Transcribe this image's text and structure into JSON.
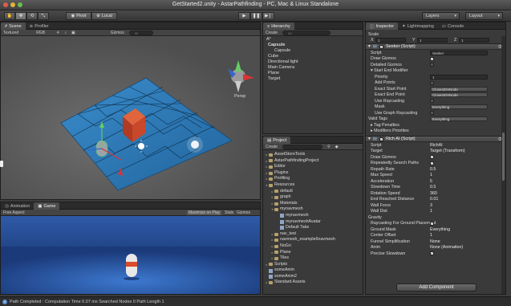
{
  "window": {
    "title": "GetStarted2.unity - AstarPathfinding - PC, Mac & Linux Standalone"
  },
  "toolbar": {
    "pivot_label": "Pivot",
    "local_label": "Local",
    "layers_label": "Layers",
    "layout_label": "Layout"
  },
  "scene_panel": {
    "tabs": [
      "Scene",
      "Profiler"
    ],
    "shading_mode": "Textured",
    "render_mode": "RGB",
    "gizmos_label": "Gizmos",
    "search_placeholder": "All",
    "persp_label": "Persp"
  },
  "game_panel": {
    "tabs": [
      "Animation",
      "Game"
    ],
    "aspect": "Free Aspect",
    "maximize_label": "Maximize on Play",
    "stats_label": "Stats",
    "gizmos_label": "Gizmos"
  },
  "hierarchy": {
    "tab": "Hierarchy",
    "create_label": "Create",
    "search_placeholder": "All",
    "rows": [
      {
        "label": "Capsule",
        "bold": true
      },
      {
        "label": "Capsule",
        "child": true
      },
      {
        "label": "Cube"
      },
      {
        "label": "Directional light"
      },
      {
        "label": "Main Camera"
      },
      {
        "label": "Plane"
      },
      {
        "label": "Target"
      }
    ]
  },
  "project": {
    "tab": "Project",
    "create_label": "Create",
    "rows": [
      {
        "label": "AssetStoreTools",
        "depth": 0,
        "type": "folder"
      },
      {
        "label": "AstarPathfindingProject",
        "depth": 0,
        "type": "folder"
      },
      {
        "label": "Editor",
        "depth": 0,
        "type": "folder"
      },
      {
        "label": "Plugins",
        "depth": 0,
        "type": "folder"
      },
      {
        "label": "Profiling",
        "depth": 0,
        "type": "folder"
      },
      {
        "label": "Resources",
        "depth": 0,
        "type": "folder",
        "open": true
      },
      {
        "label": "default",
        "depth": 1,
        "type": "folder"
      },
      {
        "label": "graph",
        "depth": 1,
        "type": "folder"
      },
      {
        "label": "Materials",
        "depth": 1,
        "type": "folder"
      },
      {
        "label": "mynavmesh",
        "depth": 1,
        "type": "folder",
        "open": true
      },
      {
        "label": "mynavmesh",
        "depth": 2,
        "type": "asset"
      },
      {
        "label": "mynavmeshAvatar",
        "depth": 2,
        "type": "asset"
      },
      {
        "label": "Default Take",
        "depth": 2,
        "type": "asset"
      },
      {
        "label": "nav_test",
        "depth": 1,
        "type": "folder"
      },
      {
        "label": "navmesh_example6navmesh",
        "depth": 1,
        "type": "folder"
      },
      {
        "label": "NoGri",
        "depth": 1,
        "type": "folder"
      },
      {
        "label": "Plane",
        "depth": 1,
        "type": "folder"
      },
      {
        "label": "Tiles",
        "depth": 1,
        "type": "folder"
      },
      {
        "label": "Scripts",
        "depth": 0,
        "type": "folder"
      },
      {
        "label": "someAnim",
        "depth": 0,
        "type": "asset"
      },
      {
        "label": "someAnim2",
        "depth": 0,
        "type": "asset"
      },
      {
        "label": "Standard Assets",
        "depth": 0,
        "type": "folder"
      }
    ]
  },
  "inspector": {
    "tabs": [
      "Inspector",
      "Lightmapping",
      "Console"
    ],
    "scale_label": "Scale",
    "scale": {
      "x_label": "X",
      "x": "1",
      "y_label": "Y",
      "y": "1",
      "z_label": "Z",
      "z": "1"
    },
    "seeker": {
      "header": "Seeker (Script)",
      "script_label": "Script",
      "script_value": "Seeker",
      "rows": [
        {
          "label": "Draw Gizmos",
          "kind": "check",
          "value": true
        },
        {
          "label": "Detailed Gizmos",
          "kind": "check",
          "value": false
        }
      ],
      "start_end_label": "Start End Modifier",
      "sub_rows": [
        {
          "label": "Priority",
          "kind": "field",
          "value": "1"
        },
        {
          "label": "Add Points",
          "kind": "check",
          "value": false
        },
        {
          "label": "Exact Start Point",
          "kind": "drop",
          "value": "ClosestOnNode"
        },
        {
          "label": "Exact End Point",
          "kind": "drop",
          "value": "ClosestOnNode"
        },
        {
          "label": "Use Raycasting",
          "kind": "check",
          "value": false
        },
        {
          "label": "Mask",
          "kind": "drop",
          "value": "Everything"
        },
        {
          "label": "Use Graph Raycasting",
          "kind": "check",
          "value": false
        }
      ],
      "valid_tags_label": "Valid Tags",
      "valid_tags_value": "Everything",
      "tag_penalties_label": "Tag Penalties",
      "modifier_priorities_label": "Modifiers Priorities"
    },
    "richai": {
      "header": "Rich AI (Script)",
      "rows": [
        {
          "label": "Script",
          "kind": "val",
          "value": "RichAI"
        },
        {
          "label": "Target",
          "kind": "val",
          "value": "Target (Transform)"
        },
        {
          "label": "Draw Gizmos",
          "kind": "check",
          "value": true
        },
        {
          "label": "Repeatedly Search Paths",
          "kind": "check",
          "value": true
        },
        {
          "label": "Repath Rate",
          "kind": "val",
          "value": "0.5"
        },
        {
          "label": "Max Speed",
          "kind": "val",
          "value": "1"
        },
        {
          "label": "Acceleration",
          "kind": "val",
          "value": "5"
        },
        {
          "label": "Slowdown Time",
          "kind": "val",
          "value": "0.5"
        },
        {
          "label": "Rotation Speed",
          "kind": "val",
          "value": "360"
        },
        {
          "label": "End Reached Distance",
          "kind": "val",
          "value": "0.01"
        },
        {
          "label": "Wall Force",
          "kind": "val",
          "value": "3"
        },
        {
          "label": "Wall Dist",
          "kind": "val",
          "value": "1"
        },
        {
          "label": "Gravity",
          "kind": "header"
        },
        {
          "label": "Raycasting For Ground Placement",
          "kind": "check",
          "value": true
        },
        {
          "label": "Ground Mask",
          "kind": "val",
          "value": "Everything"
        },
        {
          "label": "Center Offset",
          "kind": "val",
          "value": "1"
        },
        {
          "label": "Funnel Simplification",
          "kind": "val",
          "value": "None"
        },
        {
          "label": "Anim",
          "kind": "val",
          "value": "None (Animation)"
        },
        {
          "label": "Precise Slowdown",
          "kind": "check",
          "value": true
        }
      ]
    },
    "add_component_label": "Add Component"
  },
  "status": {
    "text": "Path Completed : Computation Time 0.07 ms Searched Nodes 0 Path Length 1"
  },
  "colors": {
    "plane": "#2b7bb8",
    "cube": "#c3452a",
    "sky": "#2f5aa8"
  }
}
